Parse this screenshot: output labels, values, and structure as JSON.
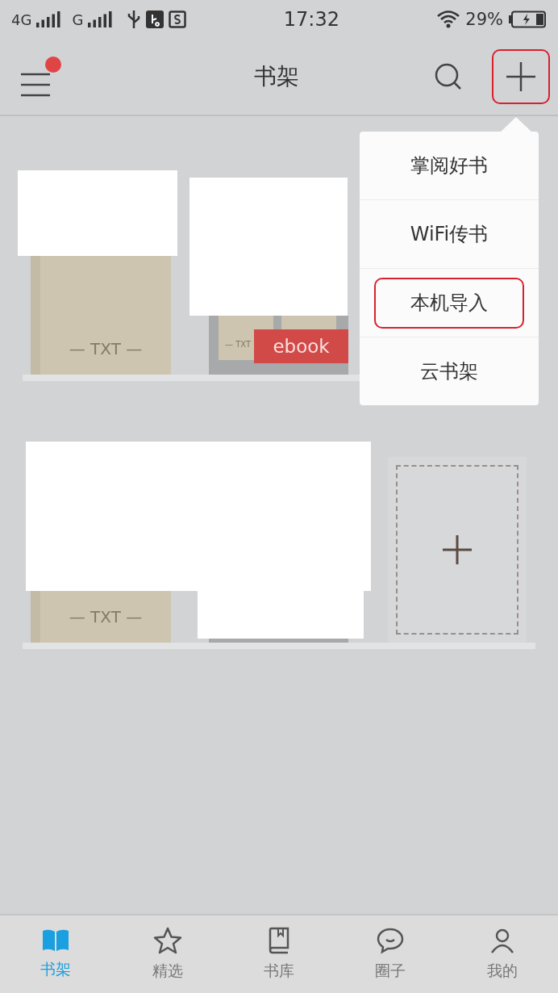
{
  "status_bar": {
    "network_1": "4G",
    "network_2": "G",
    "time": "17:32",
    "battery": "29%"
  },
  "header": {
    "title": "书架",
    "menu_badge": true,
    "add_highlighted": true
  },
  "shelves": [
    {
      "books": [
        {
          "kind": "book",
          "label": "— TXT —"
        },
        {
          "kind": "folder",
          "mini_label": "— TXT",
          "badge": "ebook"
        }
      ]
    },
    {
      "books": [
        {
          "kind": "book",
          "label": "— TXT —"
        },
        {
          "kind": "folder"
        },
        {
          "kind": "add"
        }
      ]
    }
  ],
  "menu": [
    {
      "label": "掌阅好书",
      "highlighted": false
    },
    {
      "label": "WiFi传书",
      "highlighted": false
    },
    {
      "label": "本机导入",
      "highlighted": true
    },
    {
      "label": "云书架",
      "highlighted": false
    }
  ],
  "tabs": [
    {
      "label": "书架",
      "selected": true
    },
    {
      "label": "精选",
      "selected": false
    },
    {
      "label": "书库",
      "selected": false
    },
    {
      "label": "圈子",
      "selected": false
    },
    {
      "label": "我的",
      "selected": false
    }
  ]
}
